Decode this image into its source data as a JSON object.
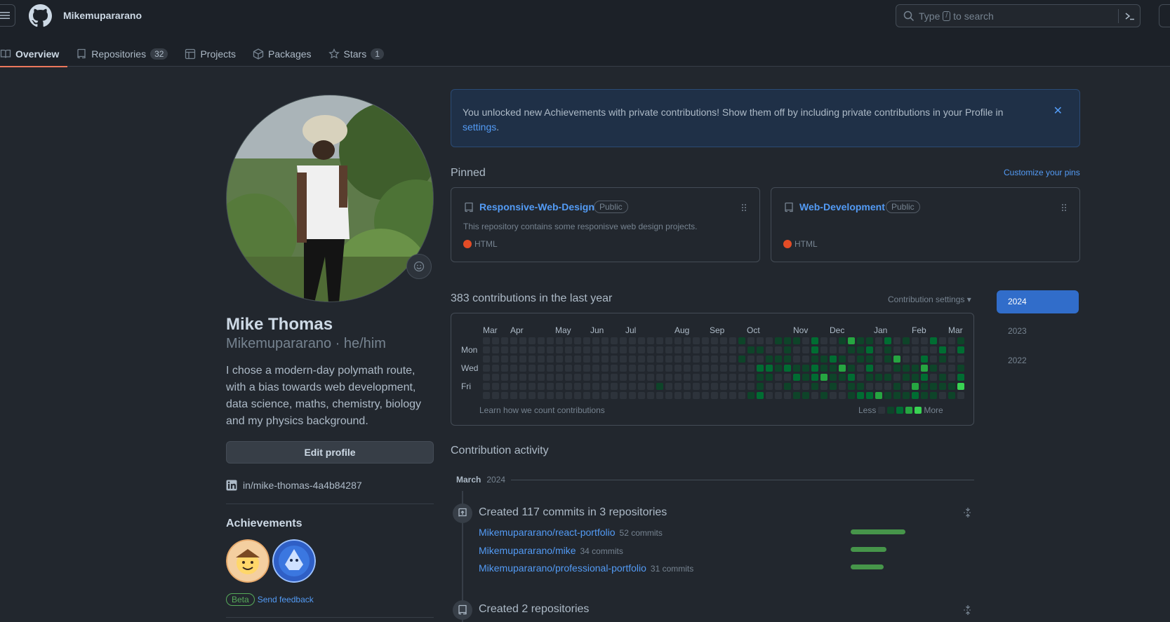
{
  "header": {
    "username": "Mikemupararano",
    "search": {
      "prefix": "Type",
      "key": "/",
      "suffix": "to search"
    }
  },
  "nav": [
    {
      "label": "Overview",
      "icon": "book-icon",
      "active": true
    },
    {
      "label": "Repositories",
      "icon": "repo-icon",
      "count": "32"
    },
    {
      "label": "Projects",
      "icon": "table-icon"
    },
    {
      "label": "Packages",
      "icon": "package-icon"
    },
    {
      "label": "Stars",
      "icon": "star-icon",
      "count": "1"
    }
  ],
  "profile": {
    "fullname": "Mike Thomas",
    "login_line": "Mikemupararano · he/him",
    "bio": "I chose a modern-day polymath route, with a bias towards web development, data science, maths, chemistry, biology and my physics background.",
    "edit_label": "Edit profile",
    "linkedin": "in/mike-thomas-4a4b84287",
    "achievements_title": "Achievements",
    "beta": "Beta",
    "feedback": "Send feedback"
  },
  "flash": {
    "text": "You unlocked new Achievements with private contributions! Show them off by including private contributions in your Profile in ",
    "link": "settings",
    "end": "."
  },
  "pinned": {
    "title": "Pinned",
    "customize": "Customize your pins",
    "cards": [
      {
        "name": "Responsive-Web-Design",
        "visibility": "Public",
        "description": "This repository contains some responisve web design projects.",
        "language": "HTML",
        "lang_color": "#e34c26"
      },
      {
        "name": "Web-Development",
        "visibility": "Public",
        "description": "",
        "language": "HTML",
        "lang_color": "#e34c26"
      }
    ]
  },
  "contributions": {
    "title": "383 contributions in the last year",
    "settings": "Contribution settings ▾",
    "months": [
      "Mar",
      "Apr",
      "May",
      "Jun",
      "Jul",
      "Aug",
      "Sep",
      "Oct",
      "Nov",
      "Dec",
      "Jan",
      "Feb",
      "Mar"
    ],
    "days": [
      "Mon",
      "Wed",
      "Fri"
    ],
    "learn": "Learn how we count contributions",
    "less": "Less",
    "more": "More",
    "levels": [
      "#2d333b",
      "#0e4429",
      "#006d32",
      "#26a641",
      "#39d353"
    ]
  },
  "years": [
    "2024",
    "2023",
    "2022"
  ],
  "activity": {
    "title": "Contribution activity",
    "month": "March",
    "year": "2024",
    "commits_heading": "Created 117 commits in 3 repositories",
    "repos": [
      {
        "name": "Mikemupararano/react-portfolio",
        "commits": "52 commits",
        "value": 52
      },
      {
        "name": "Mikemupararano/mike",
        "commits": "34 commits",
        "value": 34
      },
      {
        "name": "Mikemupararano/professional-portfolio",
        "commits": "31 commits",
        "value": 31
      }
    ],
    "created_heading": "Created 2 repositories"
  }
}
